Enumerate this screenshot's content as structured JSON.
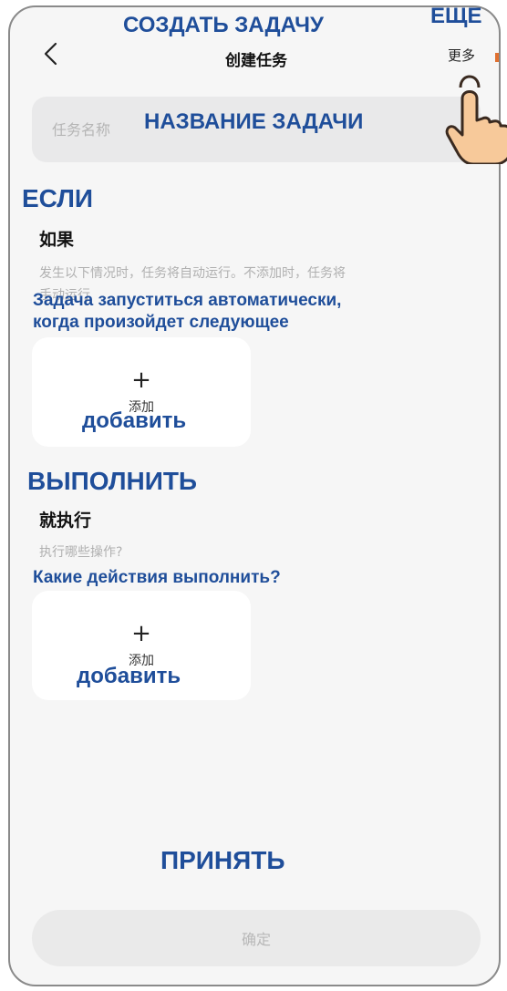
{
  "nav": {
    "title": "创建任务",
    "more": "更多"
  },
  "task_name": {
    "placeholder": "任务名称"
  },
  "if_section": {
    "title": "如果",
    "description_line1": "发生以下情况时，任务将自动运行。不添加时，任务将",
    "description_line2": "手动运行",
    "add_plus": "+",
    "add_label": "添加"
  },
  "then_section": {
    "title": "就执行",
    "description": "执行哪些操作?",
    "add_plus": "+",
    "add_label": "添加"
  },
  "confirm": {
    "label": "确定"
  },
  "annotations": {
    "create_task": "СОЗДАТЬ ЗАДАЧУ",
    "more": "ЕЩЕ",
    "task_name": "НАЗВАНИЕ ЗАДАЧИ",
    "if": "ЕСЛИ",
    "if_desc_line1": "Задача запуститься автоматически,",
    "if_desc_line2": "когда произойдет следующее",
    "add_1": "добавить",
    "execute": "ВЫПОЛНИТЬ",
    "execute_desc": "Какие действия выполнить?",
    "add_2": "добавить",
    "accept": "ПРИНЯТЬ"
  },
  "colors": {
    "annotation": "#1f4e9a",
    "background": "#f6f6f6",
    "card": "#ffffff",
    "field": "#e9e9ea"
  }
}
